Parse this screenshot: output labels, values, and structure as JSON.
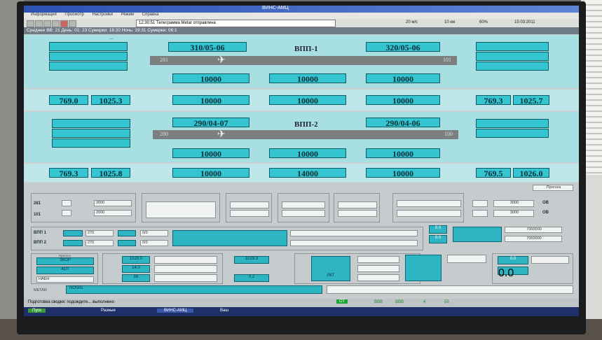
{
  "app": {
    "title": "ВИНС-АМЦ"
  },
  "menu": [
    "Информация",
    "Просмотр",
    "Настройки",
    "Режим",
    "Справка"
  ],
  "toolbar": {
    "combo_text": "12:30:51 Телеграмма Metar отправлена",
    "wind_speed": "20 м/с",
    "distance": "10 км",
    "percent": "60%",
    "time": "15:03:2011"
  },
  "infobar": {
    "text": "Среднее ВВ: 21   День: 01: 23   Сумерки: 18:20   Ночь: 19:31   Сумерки: 06:1"
  },
  "runway1": {
    "name": "ВПП-1",
    "dir_left": "281",
    "dir_right": "101",
    "left_top_value": "310/05-06",
    "right_top_value": "320/05-06",
    "row2": [
      "10000",
      "10000",
      "10000"
    ],
    "left_pressure": [
      "769.0",
      "1025.3"
    ],
    "right_pressure": [
      "769.3",
      "1025.7"
    ],
    "bottom_row": [
      "10000",
      "10000",
      "10000"
    ]
  },
  "runway2": {
    "name": "ВПП-2",
    "dir_left": "280",
    "dir_right": "100",
    "left_top_value": "290/04-07",
    "right_top_value": "290/04-06",
    "row2": [
      "10000",
      "10000",
      "10000"
    ],
    "left_pressure": [
      "769.3",
      "1025.8"
    ],
    "right_pressure": [
      "769.5",
      "1026.0"
    ],
    "bottom_row": [
      "10000",
      "14000",
      "10000"
    ]
  },
  "panel": {
    "label_281": "281",
    "label_101": "101",
    "vis_values": [
      "3000",
      "2000"
    ],
    "right_values": [
      "3000",
      "3000"
    ],
    "right_units": [
      "ОВ",
      "ОВ"
    ],
    "vpp1_label": "ВПП 1",
    "vpp2_label": "ВПП 2",
    "vpp1_combo": "270",
    "vpp2_combo": "270",
    "vpp_val": [
      "0/0",
      "0/0"
    ],
    "side_values": [
      "0.0",
      "0.0"
    ],
    "long_values": [
      "7000000",
      "7000000"
    ],
    "left_labels": [
      "ЗКОР",
      "4ОТ"
    ],
    "left_label_top": "Прогноз",
    "combo_mode": "НАЕН",
    "center_values": [
      "1029.0",
      "14.0",
      "56"
    ],
    "pressure_box": "1029.3",
    "small_box": "0.2",
    "cloud_value": "ЛКТ",
    "metar_label": "METAR",
    "metar_text": "NOSIG",
    "forecast_btn": "Прогноз",
    "right_small": [
      "0.0",
      "0.0"
    ]
  },
  "status": {
    "left": "Подготовка сводки: подождите... выполнено",
    "indicator": "ОТ",
    "numbers": [
      "ВВВ",
      "ВВВ",
      "4",
      "55"
    ]
  },
  "taskbar": {
    "start": "Пуск",
    "items": [
      "Разные",
      "ВИНС-АМЦ",
      "Ваш"
    ]
  },
  "colors": {
    "accent": "#35c5d0",
    "runway_bg": "#a7dfe3",
    "strip": "#7b7f80"
  }
}
